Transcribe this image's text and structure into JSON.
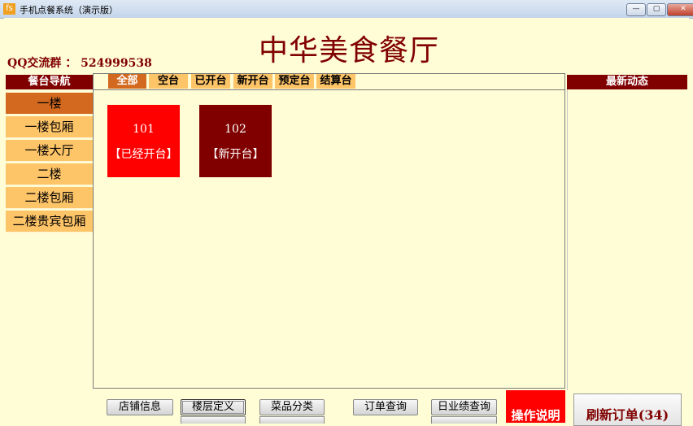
{
  "window": {
    "title": "手机点餐系统（演示版）",
    "icon_text": "fs",
    "controls": {
      "minimize": "—",
      "maximize": "▢",
      "close": "✕"
    }
  },
  "header": {
    "qq_group": "QQ交流群 ： 524999538",
    "restaurant_name": "中华美食餐厅"
  },
  "nav": {
    "title": "餐台导航",
    "items": [
      {
        "label": "一楼",
        "active": true
      },
      {
        "label": "一楼包厢"
      },
      {
        "label": "一楼大厅"
      },
      {
        "label": "二楼"
      },
      {
        "label": "二楼包厢"
      },
      {
        "label": "二楼贵宾包厢"
      }
    ]
  },
  "filters": [
    "全部",
    "空台",
    "已开台",
    "新开台",
    "预定台",
    "结算台"
  ],
  "tables": [
    {
      "number": "101",
      "status": "【已经开台】",
      "color": "#ff0000"
    },
    {
      "number": "102",
      "status": "【新开台】",
      "color": "#800000"
    }
  ],
  "news": {
    "title": "最新动态"
  },
  "buttons": {
    "shop_info": "店铺信息",
    "floor_define": "楼层定义",
    "dish_category": "菜品分类",
    "order_query": "订单查询",
    "daily_query": "日业绩查询",
    "help": "操作说明",
    "refresh": "刷新订单(34)"
  },
  "colors": {
    "background": "#fffdd6",
    "brand": "#800000",
    "nav_item": "#fec468",
    "nav_active": "#d2691e",
    "table_open": "#ff0000",
    "table_new": "#800000"
  }
}
